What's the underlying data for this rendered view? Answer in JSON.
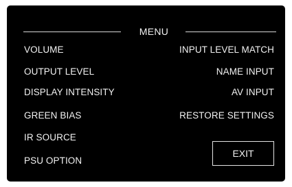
{
  "menu": {
    "title": "MENU",
    "left_items": [
      {
        "label": "VOLUME"
      },
      {
        "label": "OUTPUT LEVEL"
      },
      {
        "label": "DISPLAY INTENSITY"
      },
      {
        "label": "GREEN BIAS"
      },
      {
        "label": "IR SOURCE"
      },
      {
        "label": "PSU OPTION"
      }
    ],
    "right_items": [
      {
        "label": "INPUT LEVEL MATCH"
      },
      {
        "label": "NAME INPUT"
      },
      {
        "label": "AV INPUT"
      },
      {
        "label": "RESTORE SETTINGS"
      }
    ],
    "exit_label": "EXIT"
  },
  "colors": {
    "background": "#000000",
    "text": "#f2f2f2",
    "rule": "#d9d9d9"
  }
}
